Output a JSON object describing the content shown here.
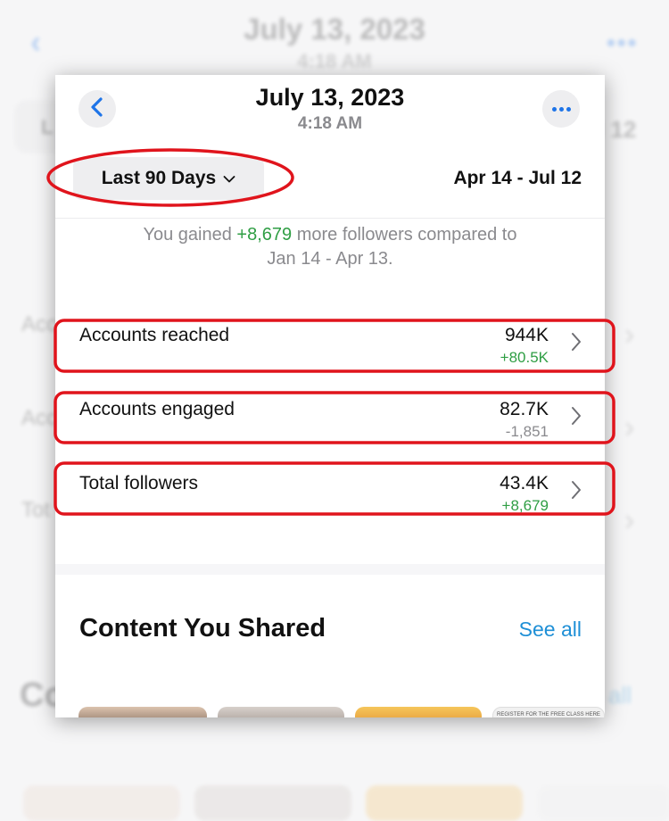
{
  "header": {
    "date": "July 13, 2023",
    "time": "4:18 AM",
    "back_icon": "chevron-left-icon",
    "more_icon": "ellipsis-icon"
  },
  "filter": {
    "period_label": "Last 90 Days",
    "date_range": "Apr 14 - Jul 12"
  },
  "summary": {
    "prefix": "You gained ",
    "gain": "+8,679",
    "suffix": " more followers compared to",
    "compare_range": "Jan 14 - Apr 13."
  },
  "metrics": [
    {
      "label": "Accounts reached",
      "value": "944K",
      "delta": "+80.5K",
      "trend": "positive"
    },
    {
      "label": "Accounts engaged",
      "value": "82.7K",
      "delta": "-1,851",
      "trend": "negative"
    },
    {
      "label": "Total followers",
      "value": "43.4K",
      "delta": "+8,679",
      "trend": "positive"
    }
  ],
  "content_section": {
    "title": "Content You Shared",
    "see_all": "See all",
    "thumbnail_caption": "REGISTER FOR THE FREE CLASS HERE"
  },
  "colors": {
    "accent_blue": "#1e74e8",
    "link_blue": "#1e8fd6",
    "positive_green": "#2f9e44",
    "muted_gray": "#8a8a8e",
    "annotation_red": "#e0141c"
  }
}
